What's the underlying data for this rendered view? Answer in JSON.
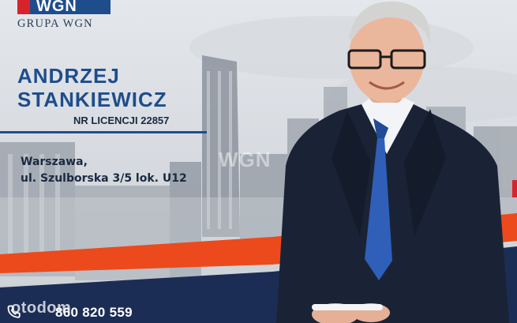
{
  "logo": {
    "brand": "WGN",
    "subtitle": "GRUPA WGN"
  },
  "agent": {
    "first_name": "ANDRZEJ",
    "last_name": "STANKIEWICZ",
    "license": "NR LICENCJI 22857"
  },
  "address": {
    "line1": "Warszawa,",
    "line2": "ul. Szulborska 3/5 lok. U12"
  },
  "watermark": "WGN",
  "contact": {
    "phone": "860 820 559",
    "site_watermark": "otodom"
  },
  "colors": {
    "brand_blue": "#1e4d8c",
    "brand_red": "#d8232a",
    "navy": "#1c2d55",
    "orange": "#ec4a1c"
  },
  "icons": {
    "phone": "phone-icon"
  }
}
